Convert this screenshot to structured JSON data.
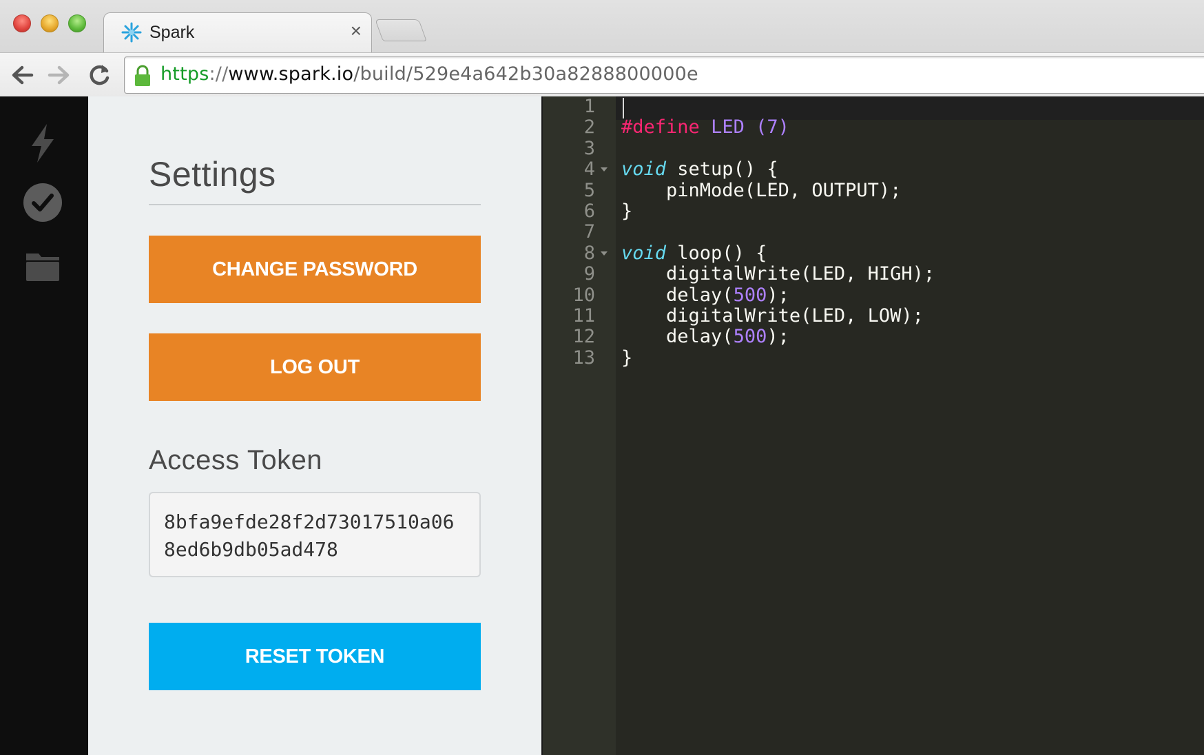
{
  "browser": {
    "tab_title": "Spark",
    "tab_close": "×",
    "url": {
      "scheme": "https",
      "separator": "://",
      "host": "www.spark.io",
      "path": "/build/529e4a642b30a8288800000e"
    }
  },
  "rail": {
    "items": [
      "flash-icon",
      "verify-icon",
      "files-icon"
    ]
  },
  "settings": {
    "title": "Settings",
    "change_password_label": "CHANGE PASSWORD",
    "logout_label": "LOG OUT",
    "access_token_label": "Access Token",
    "access_token_value": "8bfa9efde28f2d73017510a068ed6b9db05ad478",
    "reset_token_label": "RESET TOKEN"
  },
  "editor": {
    "lines": [
      {
        "n": "1",
        "tokens": []
      },
      {
        "n": "2",
        "tokens": [
          {
            "t": "#define",
            "c": "kw-pre"
          },
          {
            "t": " ",
            "c": ""
          },
          {
            "t": "LED (7)",
            "c": "purple"
          }
        ]
      },
      {
        "n": "3",
        "tokens": []
      },
      {
        "n": "4",
        "fold": true,
        "tokens": [
          {
            "t": "void",
            "c": "type"
          },
          {
            "t": " setup() {",
            "c": ""
          }
        ]
      },
      {
        "n": "5",
        "tokens": [
          {
            "t": "    pinMode(LED, OUTPUT);",
            "c": ""
          }
        ]
      },
      {
        "n": "6",
        "tokens": [
          {
            "t": "}",
            "c": ""
          }
        ]
      },
      {
        "n": "7",
        "tokens": []
      },
      {
        "n": "8",
        "fold": true,
        "tokens": [
          {
            "t": "void",
            "c": "type"
          },
          {
            "t": " loop() {",
            "c": ""
          }
        ]
      },
      {
        "n": "9",
        "tokens": [
          {
            "t": "    digitalWrite(LED, HIGH);",
            "c": ""
          }
        ]
      },
      {
        "n": "10",
        "tokens": [
          {
            "t": "    delay(",
            "c": ""
          },
          {
            "t": "500",
            "c": "purple"
          },
          {
            "t": ");",
            "c": ""
          }
        ]
      },
      {
        "n": "11",
        "tokens": [
          {
            "t": "    digitalWrite(LED, LOW);",
            "c": ""
          }
        ]
      },
      {
        "n": "12",
        "tokens": [
          {
            "t": "    delay(",
            "c": ""
          },
          {
            "t": "500",
            "c": "purple"
          },
          {
            "t": ");",
            "c": ""
          }
        ]
      },
      {
        "n": "13",
        "tokens": [
          {
            "t": "}",
            "c": ""
          }
        ]
      }
    ]
  },
  "colors": {
    "orange": "#e88425",
    "blue": "#00adef",
    "rail_bg": "#0e0e0e",
    "panel_bg": "#edf0f1",
    "editor_bg": "#272822"
  }
}
